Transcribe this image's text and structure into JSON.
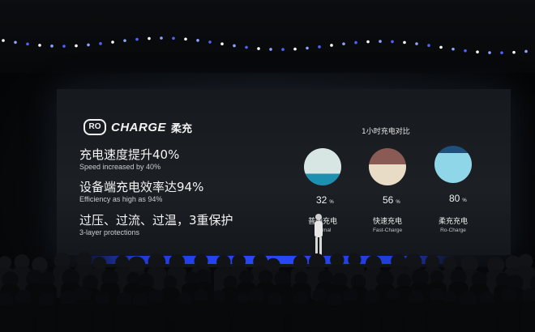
{
  "logo": {
    "badge": "RO",
    "word": "CHARGE",
    "cn": "柔充"
  },
  "features": [
    {
      "cn": "充电速度提升40%",
      "en": "Speed increased by 40%"
    },
    {
      "cn": "设备端充电效率达94%",
      "en": "Efficiency as high as 94%"
    },
    {
      "cn": "过压、过流、过温，3重保护",
      "en": "3-layer protections"
    }
  ],
  "comparison": {
    "title": "1小时充电对比",
    "unit": "%",
    "items": [
      {
        "value": "32",
        "fraction": 0.32,
        "cn": "普通充电",
        "en": "Normal",
        "top_color": "#d7e6e3",
        "fill_color": "#1d8fb0"
      },
      {
        "value": "56",
        "fraction": 0.56,
        "cn": "快速充电",
        "en": "Fast-Charge",
        "top_color": "#8a5b55",
        "fill_color": "#e8dcc7"
      },
      {
        "value": "80",
        "fraction": 0.8,
        "cn": "柔充充电",
        "en": "Ro-Charge",
        "top_color": "#1f4f7a",
        "fill_color": "#8fd6e8"
      }
    ]
  },
  "colors": {
    "stage_blue": "#2a47ff",
    "screen_bg": "#1a1d22"
  }
}
